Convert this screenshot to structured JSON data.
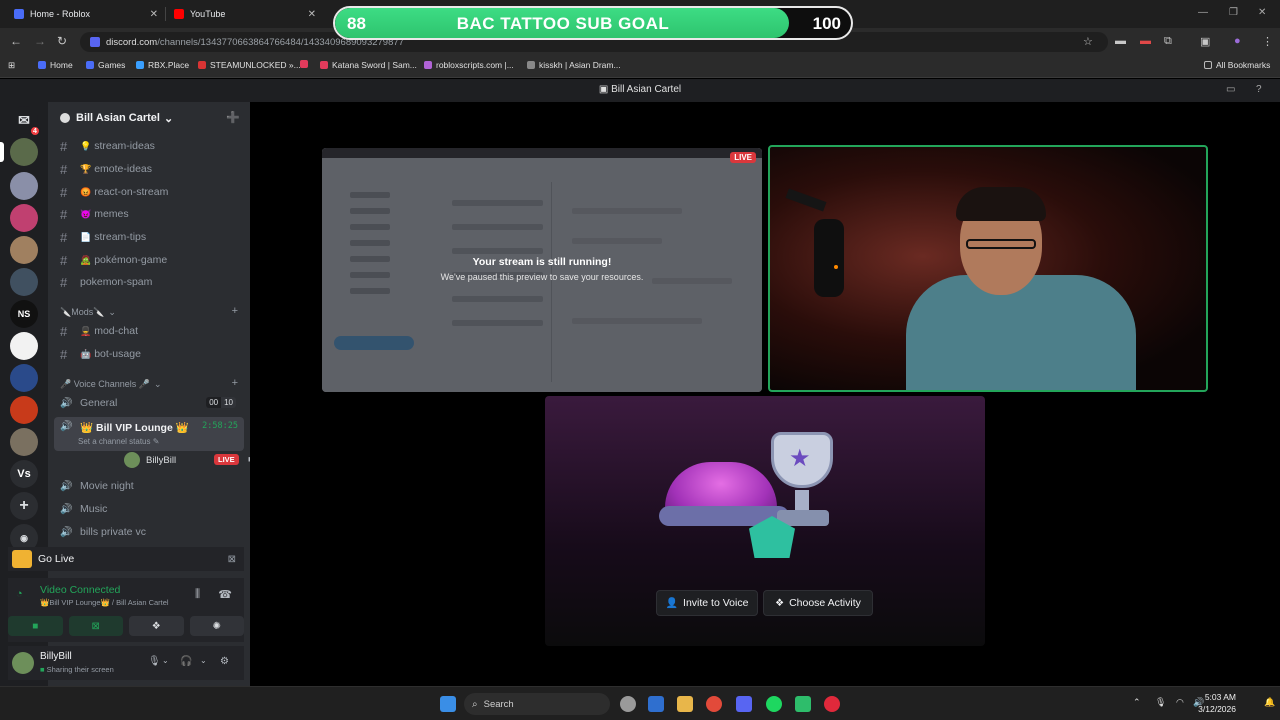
{
  "browser": {
    "tabs": [
      {
        "title": "Home - Roblox",
        "color": "#4a6cf7"
      },
      {
        "title": "YouTube",
        "color": "#ff0000"
      }
    ],
    "url_host": "discord.com",
    "url_path": "/channels/1343770663864766484/1433409689093279877",
    "bookmarks": [
      "Home",
      "Games",
      "RBX.Place",
      "STEAMUNLOCKED »...",
      "Katana Sword | Sam...",
      "robloxscripts.com |...",
      "kisskh | Asian Dram..."
    ],
    "all_bookmarks": "All Bookmarks"
  },
  "subgoal": {
    "current": "88",
    "title": "BAC TATTOO SUB GOAL",
    "target": "100",
    "progress": 0.88
  },
  "discord": {
    "window_title": "Bill Asian Cartel",
    "rail_badge": "4",
    "rail_label_ns": "NS",
    "rail_label_vs": "Vs",
    "guild_name": "Bill Asian Cartel",
    "channels": [
      {
        "emoji": "💡",
        "name": "stream-ideas"
      },
      {
        "emoji": "🏆",
        "name": "emote-ideas"
      },
      {
        "emoji": "😡",
        "name": "react-on-stream"
      },
      {
        "emoji": "😈",
        "name": "memes"
      },
      {
        "emoji": "📄",
        "name": "stream-tips"
      },
      {
        "emoji": "🧟",
        "name": "pokémon-game"
      },
      {
        "emoji": "",
        "name": "pokemon-spam"
      }
    ],
    "mods_category": "🔪Mods🔪",
    "mod_channels": [
      {
        "emoji": "💂",
        "name": "mod-chat"
      },
      {
        "emoji": "🤖",
        "name": "bot-usage"
      }
    ],
    "voice_category": "🎤 Voice Channels 🎤",
    "voice_general": {
      "name": "General",
      "count_a": "00",
      "count_b": "10"
    },
    "voice_active": {
      "name": "👑 Bill VIP Lounge 👑",
      "status": "Set a channel status",
      "timer": "2:58:25"
    },
    "voice_member": {
      "name": "BillyBill",
      "live": "LIVE"
    },
    "voice_others": [
      "Movie night",
      "Music",
      "bills private vc"
    ],
    "go_live": "Go Live",
    "voice_connected": "Video Connected",
    "voice_location": "👑Bill VIP Lounge👑 / Bill Asian Cartel",
    "user_name": "BillyBill",
    "user_status": "Sharing their screen"
  },
  "stage": {
    "paused_title": "Your stream is still running!",
    "paused_sub": "We've paused this preview to save your resources.",
    "live": "LIVE",
    "invite_label": "Invite to Voice",
    "choose_label": "Choose Activity"
  },
  "taskbar": {
    "search": "Search",
    "time": "5:03 AM",
    "date": "3/12/2026"
  }
}
